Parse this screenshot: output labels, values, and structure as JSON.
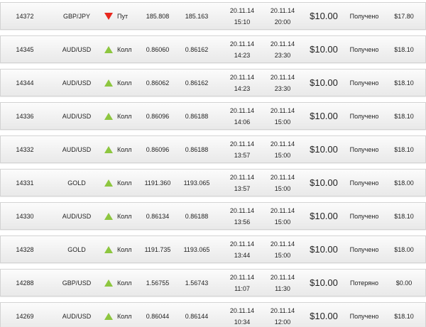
{
  "colors": {
    "up_arrow": "#8dc63f",
    "down_arrow": "#e8281e"
  },
  "trades": [
    {
      "id": "14372",
      "asset": "GBP/JPY",
      "direction": "down",
      "direction_label": "Пут",
      "open_price": "185.808",
      "close_price": "185.163",
      "open_date": "20.11.14",
      "open_time": "15:10",
      "close_date": "20.11.14",
      "close_time": "20:00",
      "amount": "$10.00",
      "status": "Получено",
      "payout": "$17.80"
    },
    {
      "id": "14345",
      "asset": "AUD/USD",
      "direction": "up",
      "direction_label": "Колл",
      "open_price": "0.86060",
      "close_price": "0.86162",
      "open_date": "20.11.14",
      "open_time": "14:23",
      "close_date": "20.11.14",
      "close_time": "23:30",
      "amount": "$10.00",
      "status": "Получено",
      "payout": "$18.10"
    },
    {
      "id": "14344",
      "asset": "AUD/USD",
      "direction": "up",
      "direction_label": "Колл",
      "open_price": "0.86062",
      "close_price": "0.86162",
      "open_date": "20.11.14",
      "open_time": "14:23",
      "close_date": "20.11.14",
      "close_time": "23:30",
      "amount": "$10.00",
      "status": "Получено",
      "payout": "$18.10"
    },
    {
      "id": "14336",
      "asset": "AUD/USD",
      "direction": "up",
      "direction_label": "Колл",
      "open_price": "0.86096",
      "close_price": "0.86188",
      "open_date": "20.11.14",
      "open_time": "14:06",
      "close_date": "20.11.14",
      "close_time": "15:00",
      "amount": "$10.00",
      "status": "Получено",
      "payout": "$18.10"
    },
    {
      "id": "14332",
      "asset": "AUD/USD",
      "direction": "up",
      "direction_label": "Колл",
      "open_price": "0.86096",
      "close_price": "0.86188",
      "open_date": "20.11.14",
      "open_time": "13:57",
      "close_date": "20.11.14",
      "close_time": "15:00",
      "amount": "$10.00",
      "status": "Получено",
      "payout": "$18.10"
    },
    {
      "id": "14331",
      "asset": "GOLD",
      "direction": "up",
      "direction_label": "Колл",
      "open_price": "1191.360",
      "close_price": "1193.065",
      "open_date": "20.11.14",
      "open_time": "13:57",
      "close_date": "20.11.14",
      "close_time": "15:00",
      "amount": "$10.00",
      "status": "Получено",
      "payout": "$18.00"
    },
    {
      "id": "14330",
      "asset": "AUD/USD",
      "direction": "up",
      "direction_label": "Колл",
      "open_price": "0.86134",
      "close_price": "0.86188",
      "open_date": "20.11.14",
      "open_time": "13:56",
      "close_date": "20.11.14",
      "close_time": "15:00",
      "amount": "$10.00",
      "status": "Получено",
      "payout": "$18.10"
    },
    {
      "id": "14328",
      "asset": "GOLD",
      "direction": "up",
      "direction_label": "Колл",
      "open_price": "1191.735",
      "close_price": "1193.065",
      "open_date": "20.11.14",
      "open_time": "13:44",
      "close_date": "20.11.14",
      "close_time": "15:00",
      "amount": "$10.00",
      "status": "Получено",
      "payout": "$18.00"
    },
    {
      "id": "14288",
      "asset": "GBP/USD",
      "direction": "up",
      "direction_label": "Колл",
      "open_price": "1.56755",
      "close_price": "1.56743",
      "open_date": "20.11.14",
      "open_time": "11:07",
      "close_date": "20.11.14",
      "close_time": "11:30",
      "amount": "$10.00",
      "status": "Потеряно",
      "payout": "$0.00"
    },
    {
      "id": "14269",
      "asset": "AUD/USD",
      "direction": "up",
      "direction_label": "Колл",
      "open_price": "0.86044",
      "close_price": "0.86144",
      "open_date": "20.11.14",
      "open_time": "10:34",
      "close_date": "20.11.14",
      "close_time": "12:00",
      "amount": "$10.00",
      "status": "Получено",
      "payout": "$18.10"
    }
  ]
}
